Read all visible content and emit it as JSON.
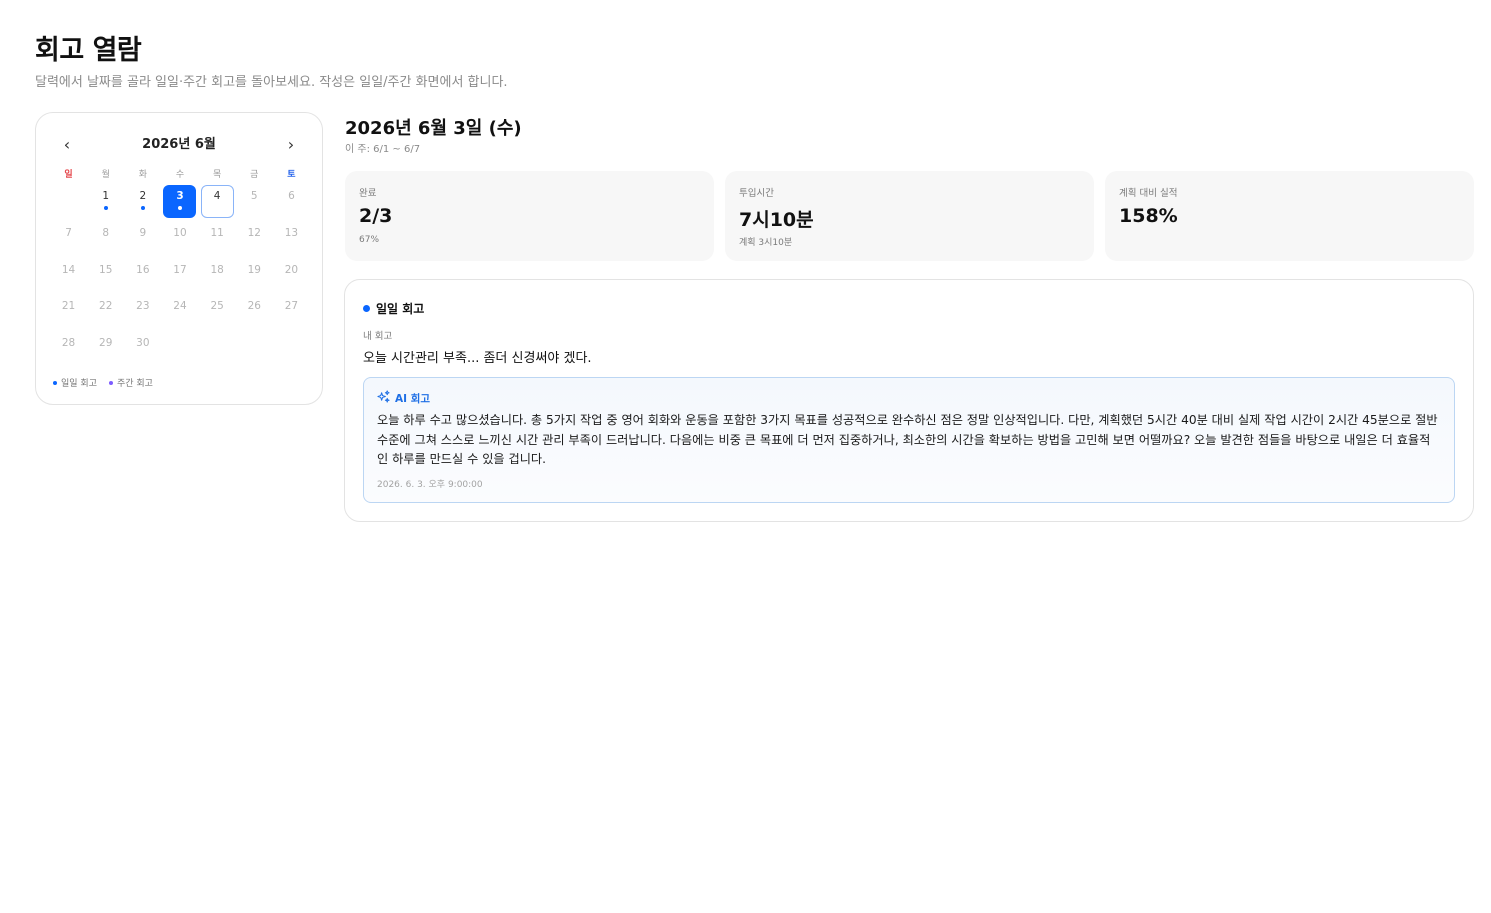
{
  "page": {
    "title": "회고 열람",
    "subtitle": "달력에서 날짜를 골라 일일·주간 회고를 돌아보세요. 작성은 일일/주간 화면에서 합니다."
  },
  "calendar": {
    "title": "2026년 6월",
    "prev_icon": "‹",
    "next_icon": "›",
    "weekdays": [
      "일",
      "월",
      "화",
      "수",
      "목",
      "금",
      "토"
    ],
    "first_weekday_offset": 1,
    "days": [
      {
        "day": "1",
        "has_entry": true
      },
      {
        "day": "2",
        "has_entry": true
      },
      {
        "day": "3",
        "has_entry": true,
        "selected": true
      },
      {
        "day": "4",
        "has_entry": false,
        "today": true
      },
      {
        "day": "5"
      },
      {
        "day": "6"
      },
      {
        "day": "7"
      },
      {
        "day": "8"
      },
      {
        "day": "9"
      },
      {
        "day": "10"
      },
      {
        "day": "11"
      },
      {
        "day": "12"
      },
      {
        "day": "13"
      },
      {
        "day": "14"
      },
      {
        "day": "15"
      },
      {
        "day": "16"
      },
      {
        "day": "17"
      },
      {
        "day": "18"
      },
      {
        "day": "19"
      },
      {
        "day": "20"
      },
      {
        "day": "21"
      },
      {
        "day": "22"
      },
      {
        "day": "23"
      },
      {
        "day": "24"
      },
      {
        "day": "25"
      },
      {
        "day": "26"
      },
      {
        "day": "27"
      },
      {
        "day": "28"
      },
      {
        "day": "29"
      },
      {
        "day": "30"
      }
    ],
    "legend": [
      {
        "label": "일일 회고",
        "color": "#0a66ff"
      },
      {
        "label": "주간 회고",
        "color": "#7c5cff"
      }
    ]
  },
  "selected": {
    "date_title": "2026년 6월 3일 (수)",
    "week_range": "이 주: 6/1 ~ 6/7"
  },
  "stats": [
    {
      "label": "완료",
      "value": "2/3",
      "sub": "67%"
    },
    {
      "label": "투입시간",
      "value": "7시10분",
      "sub": "계획 3시10분"
    },
    {
      "label": "계획 대비 실적",
      "value": "158%",
      "sub": ""
    }
  ],
  "review": {
    "header": "일일 회고",
    "my_label": "내 회고",
    "my_text": "오늘 시간관리 부족... 좀더 신경써야 겠다.",
    "ai": {
      "label": "AI 회고",
      "icon": "sparkles-icon",
      "text": "오늘 하루 수고 많으셨습니다. 총 5가지 작업 중 영어 회화와 운동을 포함한 3가지 목표를 성공적으로 완수하신 점은 정말 인상적입니다. 다만, 계획했던 5시간 40분 대비 실제 작업 시간이 2시간 45분으로 절반 수준에 그쳐 스스로 느끼신 시간 관리 부족이 드러납니다. 다음에는 비중 큰 목표에 더 먼저 집중하거나, 최소한의 시간을 확보하는 방법을 고민해 보면 어떨까요? 오늘 발견한 점들을 바탕으로 내일은 더 효율적인 하루를 만드실 수 있을 겁니다.",
      "timestamp": "2026. 6. 3. 오후 9:00:00"
    }
  },
  "colors": {
    "accent": "#0a66ff",
    "sunday": "#e5484d",
    "saturday": "#2563eb"
  }
}
